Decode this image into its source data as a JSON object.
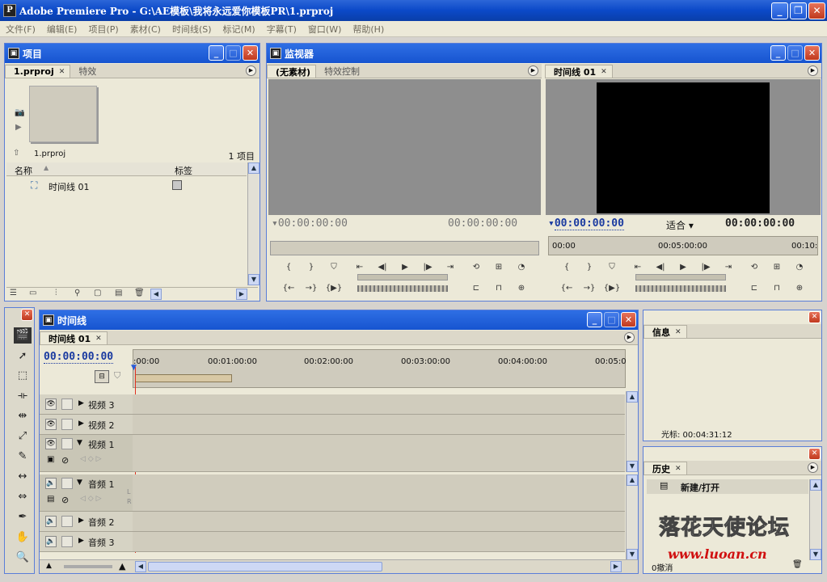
{
  "window": {
    "title": "Adobe Premiere Pro - G:\\AE模板\\我将永远爱你模板PR\\1.prproj",
    "min": "_",
    "restore": "❐",
    "close": "✕"
  },
  "menu": [
    "文件(F)",
    "编辑(E)",
    "项目(P)",
    "素材(C)",
    "时间线(S)",
    "标记(M)",
    "字幕(T)",
    "窗口(W)",
    "帮助(H)"
  ],
  "project": {
    "title": "项目",
    "tabs": [
      "1.prproj",
      "特效"
    ],
    "file": "1.prproj",
    "count": "1 项目",
    "columns": {
      "name": "名称",
      "label": "标签"
    },
    "rows": [
      {
        "name": "时间线 01"
      }
    ]
  },
  "monitor": {
    "title": "监视器",
    "source_tabs": [
      "(无素材)",
      "特效控制"
    ],
    "source_tc_left": "00:00:00:00",
    "source_tc_right": "00:00:00:00",
    "program_tab": "时间线 01",
    "program_tc_left": "00:00:00:00",
    "fit": "适合",
    "program_tc_right": "00:00:00:00",
    "ruler": [
      "00:00",
      "00:05:00:00",
      "00:10:"
    ]
  },
  "timeline": {
    "title": "时间线",
    "tab": "时间线 01",
    "timecode": "00:00:00:00",
    "ruler": [
      ":00:00",
      "00:01:00:00",
      "00:02:00:00",
      "00:03:00:00",
      "00:04:00:00",
      "00:05:0"
    ],
    "tracks": [
      {
        "name": "视频 3"
      },
      {
        "name": "视频 2"
      },
      {
        "name": "视频 1"
      },
      {
        "name": "音频 1"
      },
      {
        "name": "音频 2"
      },
      {
        "name": "音频 3"
      }
    ],
    "track_marks": {
      "l": "L",
      "r": "R"
    }
  },
  "info": {
    "tab": "信息",
    "cursor": "光标:  00:04:31:12"
  },
  "history": {
    "tab": "历史",
    "item": "新建/打开",
    "undo": "0撤消"
  },
  "watermark": {
    "line1": "落花天使论坛",
    "line2": "www.luoan.cn"
  }
}
